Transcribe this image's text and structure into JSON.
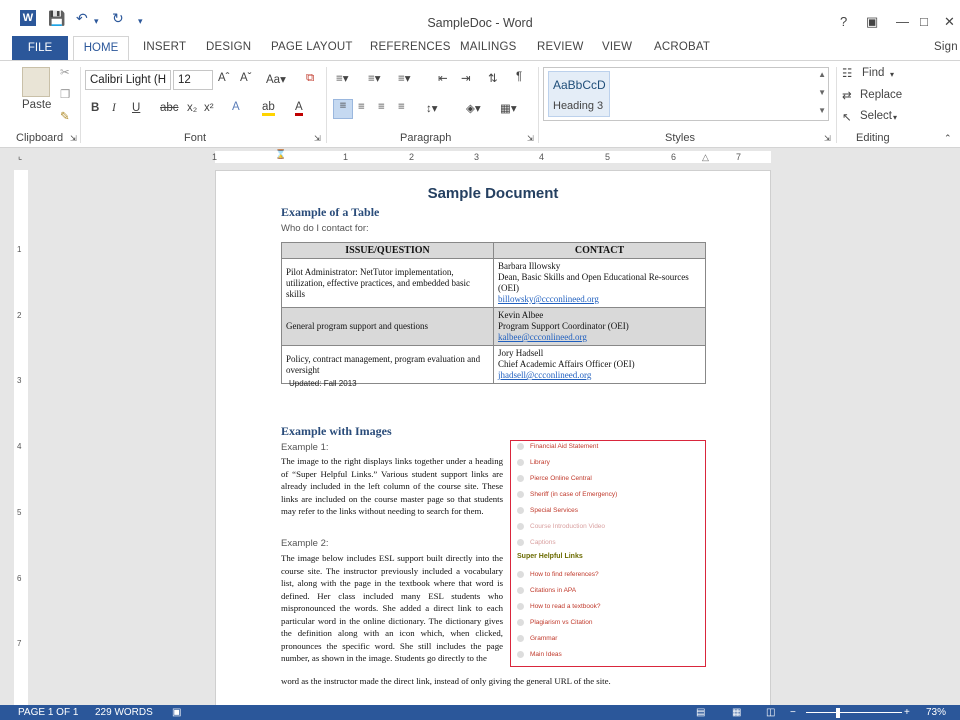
{
  "window": {
    "title": "SampleDoc - Word",
    "help": "?",
    "sign_in": "Sign"
  },
  "tabs": {
    "file": "FILE",
    "home": "HOME",
    "items": [
      "INSERT",
      "DESIGN",
      "PAGE LAYOUT",
      "REFERENCES",
      "MAILINGS",
      "REVIEW",
      "VIEW",
      "ACROBAT"
    ]
  },
  "ribbon": {
    "paste": "Paste",
    "font_name": "Calibri Light (H",
    "font_size": "12",
    "style_sample": "AaBbCcD",
    "style_name": "Heading 3",
    "find": "Find",
    "replace": "Replace",
    "select": "Select",
    "groups": {
      "clipboard": "Clipboard",
      "font": "Font",
      "paragraph": "Paragraph",
      "styles": "Styles",
      "editing": "Editing"
    }
  },
  "ruler": {
    "h_numbers": [
      "1",
      "1",
      "2",
      "3",
      "4",
      "5",
      "6",
      "7"
    ],
    "v_numbers": [
      "1",
      "2",
      "3",
      "4",
      "5",
      "6",
      "7"
    ]
  },
  "doc": {
    "heading": "Sample Document",
    "table_section": "Example of a Table",
    "who": "Who do I contact for:",
    "table_headers": [
      "ISSUE/QUESTION",
      "CONTACT"
    ],
    "rows": [
      {
        "issue": "Pilot Administrator: NetTutor implementation, utilization, effective practices, and embedded basic skills",
        "name": "Barbara Illowsky",
        "role": "Dean, Basic Skills and Open Educational Re-sources (OEI)",
        "email": "billowsky@ccconlineed.org"
      },
      {
        "issue": "General program support and questions",
        "name": "Kevin Albee",
        "role": "Program Support Coordinator (OEI)",
        "email": "kalbee@ccconlineed.org"
      },
      {
        "issue": "Policy, contract management, program evaluation and oversight",
        "name": "Jory Hadsell",
        "role": "Chief Academic Affairs Officer (OEI)",
        "email": "jhadsell@ccconlineed.org"
      }
    ],
    "updated": "Updated: Fall 2013",
    "images_section": "Example with Images",
    "example1_label": "Example 1:",
    "example1_text": "The image to the right displays links together under a heading of “Super Helpful Links.” Various student support links are already included in the left column of the course site. These links are included on the course master page so that students may refer to the links without needing to search for them.",
    "example2_label": "Example 2:",
    "example2_text": "The image below includes ESL support built directly into the course site. The instructor previously included a vocabulary list, along with the page in the textbook where that word is defined. Her class included many ESL students who mispronounced the words. She added a direct link to each particular word in the online dictionary. The dictionary gives the definition along with an icon which, when clicked, pronounces the specific word. She still includes the page number, as shown in the image. Students go directly to the",
    "last_line": "word as the instructor made the direct link, instead of only giving the general URL of the site.",
    "screenshot_links_top": [
      "Financial Aid Statement",
      "Library",
      "Pierce Online Central",
      "Sheriff (in case of Emergency)",
      "Special Services",
      "Course Introduction Video",
      "Captions"
    ],
    "helpful_title": "Super Helpful Links",
    "screenshot_links_bottom": [
      "How to find references?",
      "Citations in APA",
      "How to read a textbook?",
      "Plagiarism vs Citation",
      "Grammar",
      "Main Ideas"
    ]
  },
  "status": {
    "page": "PAGE 1 OF 1",
    "words": "229 WORDS",
    "zoom": "73%"
  }
}
